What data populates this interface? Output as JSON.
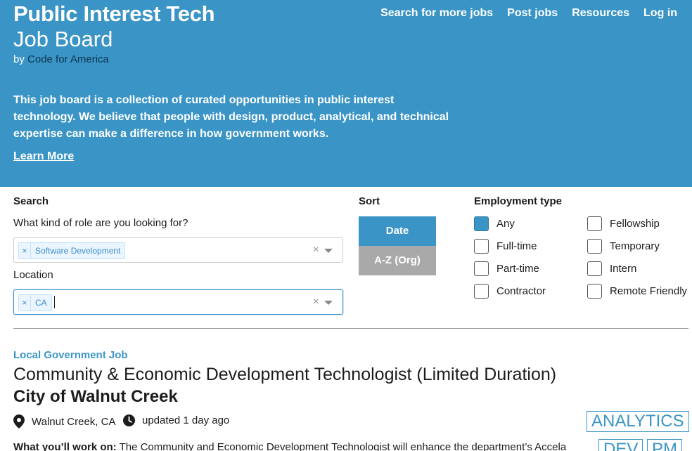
{
  "header": {
    "title": "Public Interest Tech",
    "subtitle": "Job Board",
    "by_prefix": "by",
    "org": "Code for America",
    "intro": "This job board is a collection of curated opportunities in public interest technology. We believe that people with design, product, analytical, and technical expertise can make a difference in how government works.",
    "learn_more": "Learn More"
  },
  "nav": {
    "items": [
      "Search for more jobs",
      "Post jobs",
      "Resources",
      "Log in"
    ]
  },
  "search": {
    "label": "Search",
    "role_question": "What kind of role are you looking for?",
    "role_tag": "Software Development",
    "location_label": "Location",
    "location_tag": "CA",
    "tag_remove": "×",
    "clear": "×"
  },
  "sort": {
    "label": "Sort",
    "options": [
      "Date",
      "A-Z (Org)"
    ],
    "selected": "Date"
  },
  "employment": {
    "label": "Employment type",
    "options": [
      {
        "label": "Any",
        "checked": true
      },
      {
        "label": "Fellowship",
        "checked": false
      },
      {
        "label": "Full-time",
        "checked": false
      },
      {
        "label": "Temporary",
        "checked": false
      },
      {
        "label": "Part-time",
        "checked": false
      },
      {
        "label": "Intern",
        "checked": false
      },
      {
        "label": "Contractor",
        "checked": false
      },
      {
        "label": "Remote Friendly",
        "checked": false
      }
    ]
  },
  "job": {
    "category": "Local Government Job",
    "title": "Community & Economic Development Technologist (Limited Duration)",
    "org": "City of Walnut Creek",
    "location": "Walnut Creek, CA",
    "updated": "updated 1 day ago",
    "tags": [
      "ANALYTICS",
      "DEV",
      "PM"
    ],
    "work_on_label": "What you’ll work on:",
    "work_on_text": "The Community and Economic Development Technologist will enhance the department’s Accela"
  },
  "colors": {
    "brand": "#3a95c6",
    "org_link": "#0d3550",
    "sort_inactive": "#a9a9a9"
  }
}
